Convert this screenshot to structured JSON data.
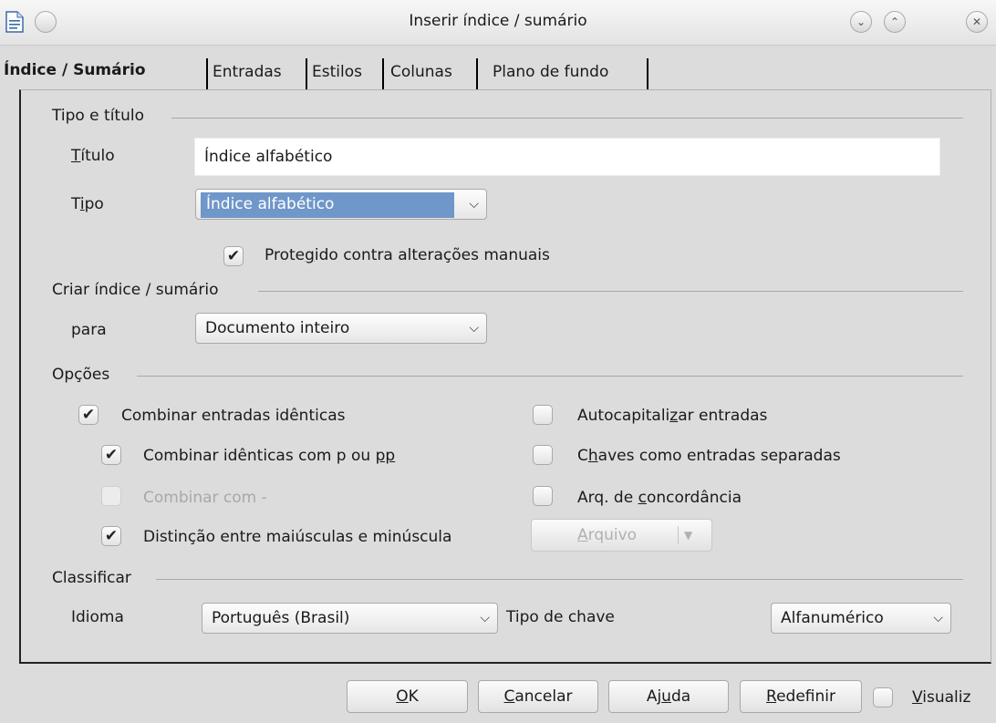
{
  "window": {
    "title": "Inserir índice / sumário"
  },
  "tabs": [
    "Índice / Sumário",
    "Entradas",
    "Estilos",
    "Colunas",
    "Plano de fundo"
  ],
  "type_title": {
    "group": "Tipo e título",
    "title_label_u": "T",
    "title_label_rest": "ítulo",
    "title_value": "Índice alfabético",
    "type_label_a": "T",
    "type_label_u": "i",
    "type_label_b": "po",
    "type_value": "Índice alfabético",
    "protected_a": "Prote",
    "protected_u": "g",
    "protected_b": "ido contra alterações manuais",
    "protected_checked": true
  },
  "create": {
    "group": "Criar índice / sumário",
    "for_label": "para",
    "for_value": "Documento inteiro"
  },
  "options": {
    "group": "Opções",
    "combine_identical": "Combinar entradas idênticas",
    "combine_p_pp_a": "Combinar idênticas com p ou ",
    "combine_p_pp_u": "pp",
    "combine_with": "Combinar com -",
    "case_distinction": "Distinção entre maiúsculas e minúscula",
    "autocap_a": "Autocapitali",
    "autocap_u": "z",
    "autocap_b": "ar entradas",
    "keys_a": "C",
    "keys_u": "h",
    "keys_b": "aves como entradas separadas",
    "concordance_a": "Arq. de ",
    "concordance_u": "c",
    "concordance_b": "oncordância",
    "file_button_u": "A",
    "file_button_rest": "rquivo"
  },
  "sort": {
    "group": "Classificar",
    "language_label": "Idioma",
    "language_value": "Português (Brasil)",
    "key_type_label": "Tipo de chave",
    "key_type_value": "Alfanumérico"
  },
  "buttons": {
    "ok_u": "O",
    "ok_rest": "K",
    "cancel_u": "C",
    "cancel_rest": "ancelar",
    "help_a": "Aj",
    "help_u": "u",
    "help_b": "da",
    "reset_u": "R",
    "reset_rest": "edefinir",
    "preview_u": "V",
    "preview_rest": "isualiz"
  },
  "icons": {
    "check": "✔",
    "dropdown": "⌵",
    "close": "✕",
    "minimize": "⌄",
    "maximize": "⌃"
  }
}
